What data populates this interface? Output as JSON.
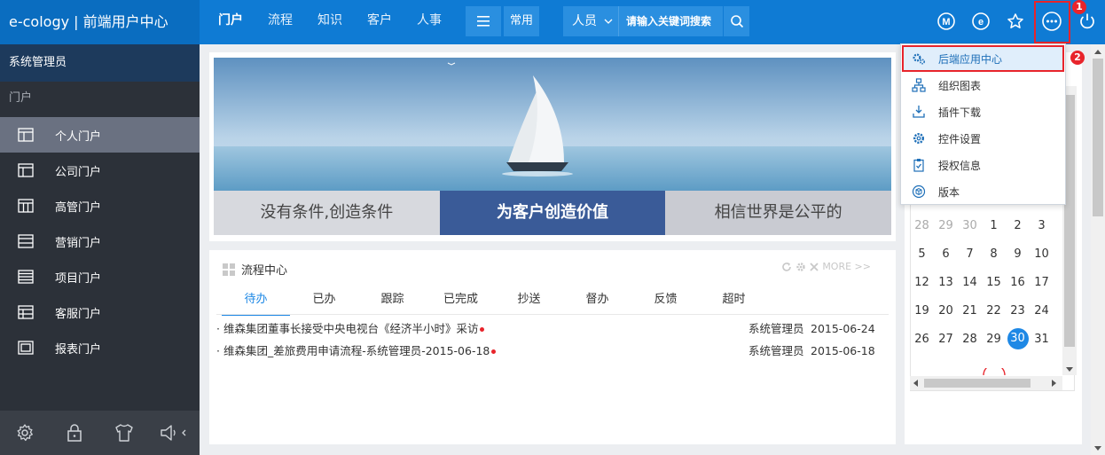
{
  "brand": "e-cology | 前端用户中心",
  "nav": [
    "门户",
    "流程",
    "知识",
    "客户",
    "人事"
  ],
  "toolbar": {
    "common_label": "常用",
    "search_type": "人员",
    "search_placeholder": "请输入关键词搜索"
  },
  "callouts": [
    "1",
    "2"
  ],
  "sidebar": {
    "user": "系统管理员",
    "section": "门户",
    "items": [
      "个人门户",
      "公司门户",
      "高管门户",
      "营销门户",
      "项目门户",
      "客服门户",
      "报表门户"
    ]
  },
  "banner": {
    "tabs": [
      "没有条件,创造条件",
      "为客户创造价值",
      "相信世界是公平的"
    ]
  },
  "workflow": {
    "title": "流程中心",
    "more": "MORE >>",
    "tabs": [
      "待办",
      "已办",
      "跟踪",
      "已完成",
      "抄送",
      "督办",
      "反馈",
      "超时"
    ],
    "rows": [
      {
        "title": "维森集团董事长接受中央电视台《经济半小时》采访",
        "creator": "系统管理员",
        "date": "2015-06-24"
      },
      {
        "title": "维森集团_差旅费用申请流程-系统管理员-2015-06-18",
        "creator": "系统管理员",
        "date": "2015-06-18"
      }
    ]
  },
  "dropdown": [
    "后端应用中心",
    "组织图表",
    "插件下载",
    "控件设置",
    "授权信息",
    "版本"
  ],
  "calendar": {
    "weeks": [
      [
        "28",
        "29",
        "30",
        "1",
        "2",
        "3"
      ],
      [
        "5",
        "6",
        "7",
        "8",
        "9",
        "10"
      ],
      [
        "12",
        "13",
        "14",
        "15",
        "16",
        "17"
      ],
      [
        "19",
        "20",
        "21",
        "22",
        "23",
        "24"
      ],
      [
        "26",
        "27",
        "28",
        "29",
        "30",
        "31"
      ]
    ],
    "today": "30"
  },
  "colors": {
    "topbar": "#0f7bd4",
    "sidebar": "#2c3139",
    "accent": "#1e88e5",
    "highlight": "#e8242b"
  }
}
